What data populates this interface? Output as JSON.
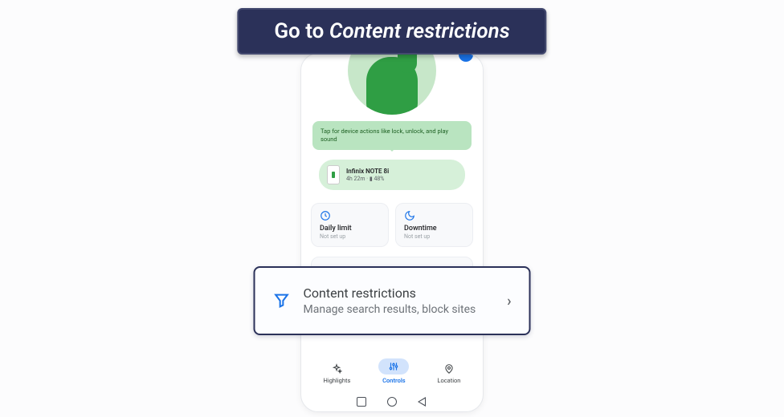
{
  "instruction": {
    "prefix": "Go to ",
    "target": "Content restrictions"
  },
  "tooltip": {
    "text": "Tap for device actions like lock, unlock, and play sound"
  },
  "device": {
    "name": "Infinix NOTE 8i",
    "duration": "4h 22m",
    "battery": "48%"
  },
  "cards": {
    "daily": {
      "title": "Daily limit",
      "sub": "Not set up"
    },
    "downtime": {
      "title": "Downtime",
      "sub": "Not set up"
    }
  },
  "content_card": {
    "title": "Content restrictions",
    "sub": "Manage search results, block sites"
  },
  "tabs": {
    "highlights": "Highlights",
    "controls": "Controls",
    "location": "Location"
  },
  "callout": {
    "title": "Content restrictions",
    "sub": "Manage search results, block sites"
  }
}
